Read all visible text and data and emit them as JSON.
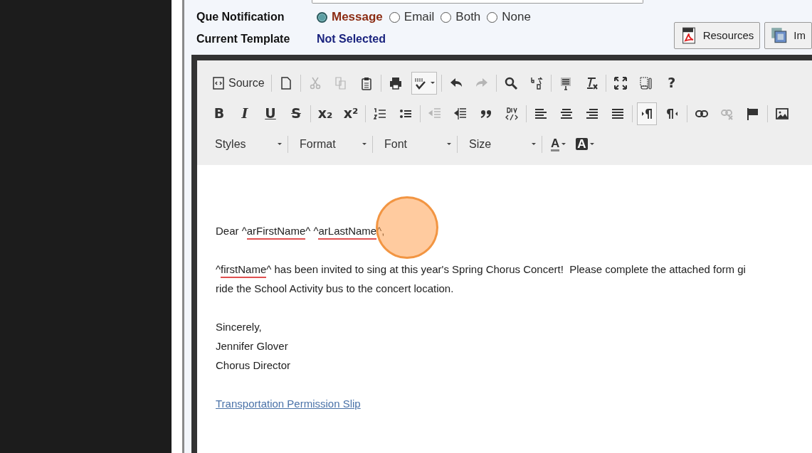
{
  "notification": {
    "label": "Que Notification",
    "options": [
      {
        "label": "Message",
        "selected": true
      },
      {
        "label": "Email",
        "selected": false
      },
      {
        "label": "Both",
        "selected": false
      },
      {
        "label": "None",
        "selected": false
      }
    ]
  },
  "template": {
    "label": "Current Template",
    "value": "Not Selected"
  },
  "buttons": [
    {
      "label": "Resources",
      "kind": "pdf"
    },
    {
      "label": "Im",
      "kind": "image"
    }
  ],
  "toolbar": {
    "rows": [
      [
        [
          {
            "kind": "source",
            "label": "Source",
            "disabled": false,
            "pressed": false
          }
        ],
        [
          {
            "kind": "newpage",
            "disabled": false,
            "pressed": false
          }
        ],
        [
          {
            "kind": "cut",
            "disabled": true,
            "pressed": false
          },
          {
            "kind": "copy",
            "disabled": true,
            "pressed": false
          },
          {
            "kind": "paste",
            "disabled": false,
            "pressed": false
          }
        ],
        [
          {
            "kind": "print",
            "disabled": false,
            "pressed": false
          },
          {
            "kind": "spell",
            "dropdown": true,
            "disabled": false,
            "pressed": true
          }
        ],
        [
          {
            "kind": "undo",
            "disabled": false,
            "pressed": false
          },
          {
            "kind": "redo",
            "disabled": true,
            "pressed": false
          }
        ],
        [
          {
            "kind": "find",
            "disabled": false,
            "pressed": false
          },
          {
            "kind": "replace",
            "disabled": false,
            "pressed": false
          }
        ],
        [
          {
            "kind": "selectall",
            "disabled": false,
            "pressed": false
          },
          {
            "kind": "removeformat",
            "disabled": false,
            "pressed": false
          }
        ],
        [
          {
            "kind": "maximize",
            "disabled": false,
            "pressed": false
          },
          {
            "kind": "showblocks",
            "disabled": false,
            "pressed": false
          },
          {
            "kind": "glyph",
            "label": "?",
            "disabled": false,
            "pressed": false
          }
        ]
      ],
      [
        [
          {
            "kind": "bold",
            "label": "B",
            "disabled": false,
            "pressed": false
          },
          {
            "kind": "italic",
            "label": "I",
            "disabled": false,
            "pressed": false
          },
          {
            "kind": "underline",
            "label": "U",
            "disabled": false,
            "pressed": false
          },
          {
            "kind": "strike",
            "label": "S",
            "disabled": false,
            "pressed": false
          }
        ],
        [
          {
            "kind": "subscript",
            "label": "x₂",
            "disabled": false,
            "pressed": false
          },
          {
            "kind": "superscript",
            "label": "x²",
            "disabled": false,
            "pressed": false
          }
        ],
        [
          {
            "kind": "numlist",
            "disabled": false,
            "pressed": false
          },
          {
            "kind": "bulllist",
            "disabled": false,
            "pressed": false
          }
        ],
        [
          {
            "kind": "outdent",
            "disabled": true,
            "pressed": false
          },
          {
            "kind": "indent",
            "disabled": false,
            "pressed": false
          },
          {
            "kind": "quote",
            "disabled": false,
            "pressed": false
          },
          {
            "kind": "div",
            "disabled": false,
            "pressed": false
          }
        ],
        [
          {
            "kind": "alignleft",
            "disabled": false,
            "pressed": false
          },
          {
            "kind": "aligncenter",
            "disabled": false,
            "pressed": false
          },
          {
            "kind": "alignright",
            "disabled": false,
            "pressed": false
          },
          {
            "kind": "justify",
            "disabled": false,
            "pressed": false
          }
        ],
        [
          {
            "kind": "ltr",
            "disabled": false,
            "pressed": true
          },
          {
            "kind": "rtl",
            "disabled": false,
            "pressed": false
          }
        ],
        [
          {
            "kind": "link",
            "disabled": false,
            "pressed": false
          },
          {
            "kind": "unlink",
            "disabled": true,
            "pressed": false
          },
          {
            "kind": "anchor",
            "disabled": false,
            "pressed": false
          }
        ],
        [
          {
            "kind": "image",
            "disabled": false,
            "pressed": false
          }
        ]
      ]
    ],
    "combos": [
      "Styles",
      "Format",
      "Font",
      "Size"
    ],
    "colors": [
      {
        "label": "A",
        "kind": "text"
      },
      {
        "label": "A",
        "kind": "background"
      }
    ]
  },
  "content": {
    "paragraphs": [
      [
        [
          {
            "text": "Dear ^",
            "misspelled": false
          },
          {
            "text": "arFirstName",
            "misspelled": true
          },
          {
            "text": "^ ^",
            "misspelled": false
          },
          {
            "text": "arLastName",
            "misspelled": true
          },
          {
            "text": "^,",
            "misspelled": false
          }
        ]
      ],
      [
        [
          {
            "text": "^",
            "misspelled": false
          },
          {
            "text": "firstName",
            "misspelled": true
          },
          {
            "text": "^ has been invited to sing at this year's Spring Chorus Concert!  Please complete the attached form gi",
            "misspelled": false
          }
        ],
        [
          {
            "text": "ride the School Activity bus to the concert location.",
            "misspelled": false
          }
        ]
      ],
      [
        [
          {
            "text": "Sincerely,",
            "misspelled": false
          }
        ],
        [
          {
            "text": "Jennifer Glover",
            "misspelled": false
          }
        ],
        [
          {
            "text": "Chorus Director",
            "misspelled": false
          }
        ]
      ]
    ],
    "link": "Transportation Permission Slip"
  }
}
